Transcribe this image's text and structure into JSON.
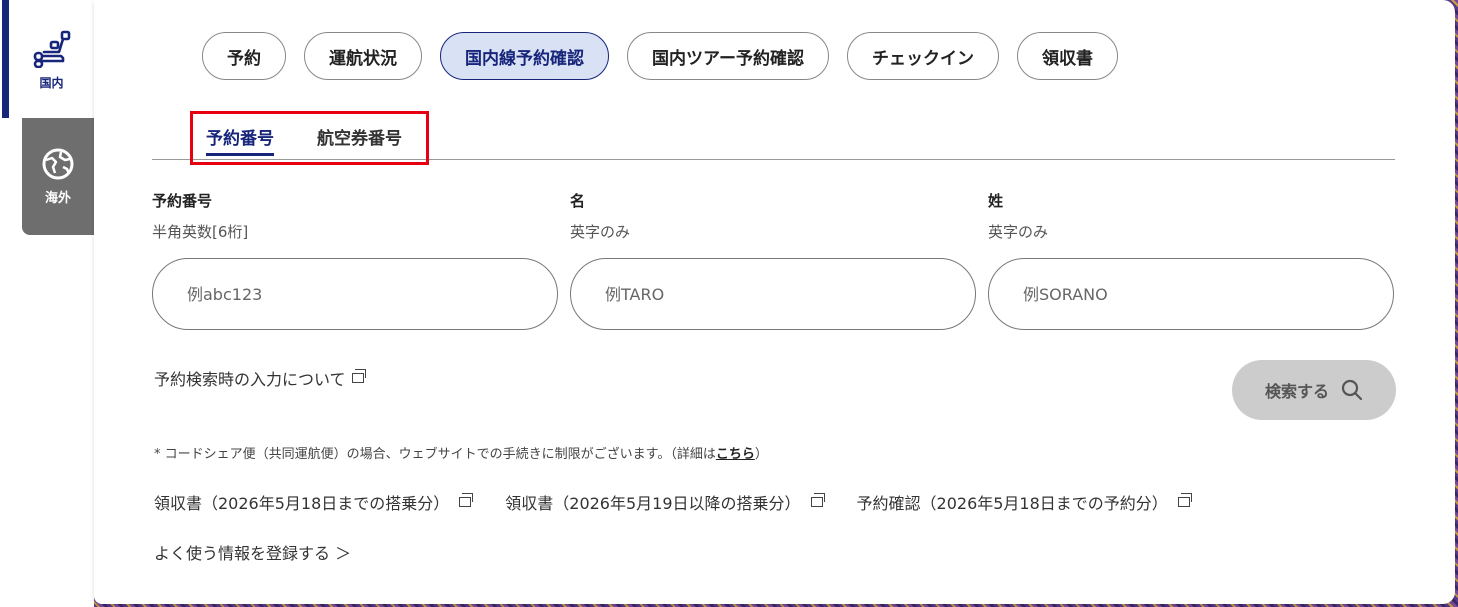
{
  "sidebar": {
    "domestic_label": "国内",
    "overseas_label": "海外"
  },
  "nav": {
    "pills": [
      {
        "label": "予約"
      },
      {
        "label": "運航状況"
      },
      {
        "label": "国内線予約確認"
      },
      {
        "label": "国内ツアー予約確認"
      },
      {
        "label": "チェックイン"
      },
      {
        "label": "領収書"
      }
    ]
  },
  "subtabs": {
    "reservation_number": "予約番号",
    "ticket_number": "航空券番号"
  },
  "form": {
    "reservation": {
      "label": "予約番号",
      "hint": "半角英数[6桁]",
      "placeholder": "例abc123"
    },
    "first_name": {
      "label": "名",
      "hint": "英字のみ",
      "placeholder": "例TARO"
    },
    "last_name": {
      "label": "姓",
      "hint": "英字のみ",
      "placeholder": "例SORANO"
    }
  },
  "info_link": "予約検索時の入力について",
  "search_button": "検索する",
  "note": {
    "text": "* コードシェア便（共同運航便）の場合、ウェブサイトでの手続きに制限がございます。（詳細は",
    "link": "こちら",
    "close": "）"
  },
  "links": [
    "領収書（2026年5月18日までの搭乗分）",
    "領収書（2026年5月19日以降の搭乗分）",
    "予約確認（2026年5月18日までの予約分）"
  ],
  "register_link": "よく使う情報を登録する ＞",
  "colors": {
    "accent": "#17257a",
    "highlight": "#e60012",
    "active_pill_bg": "#d9e2f5"
  }
}
